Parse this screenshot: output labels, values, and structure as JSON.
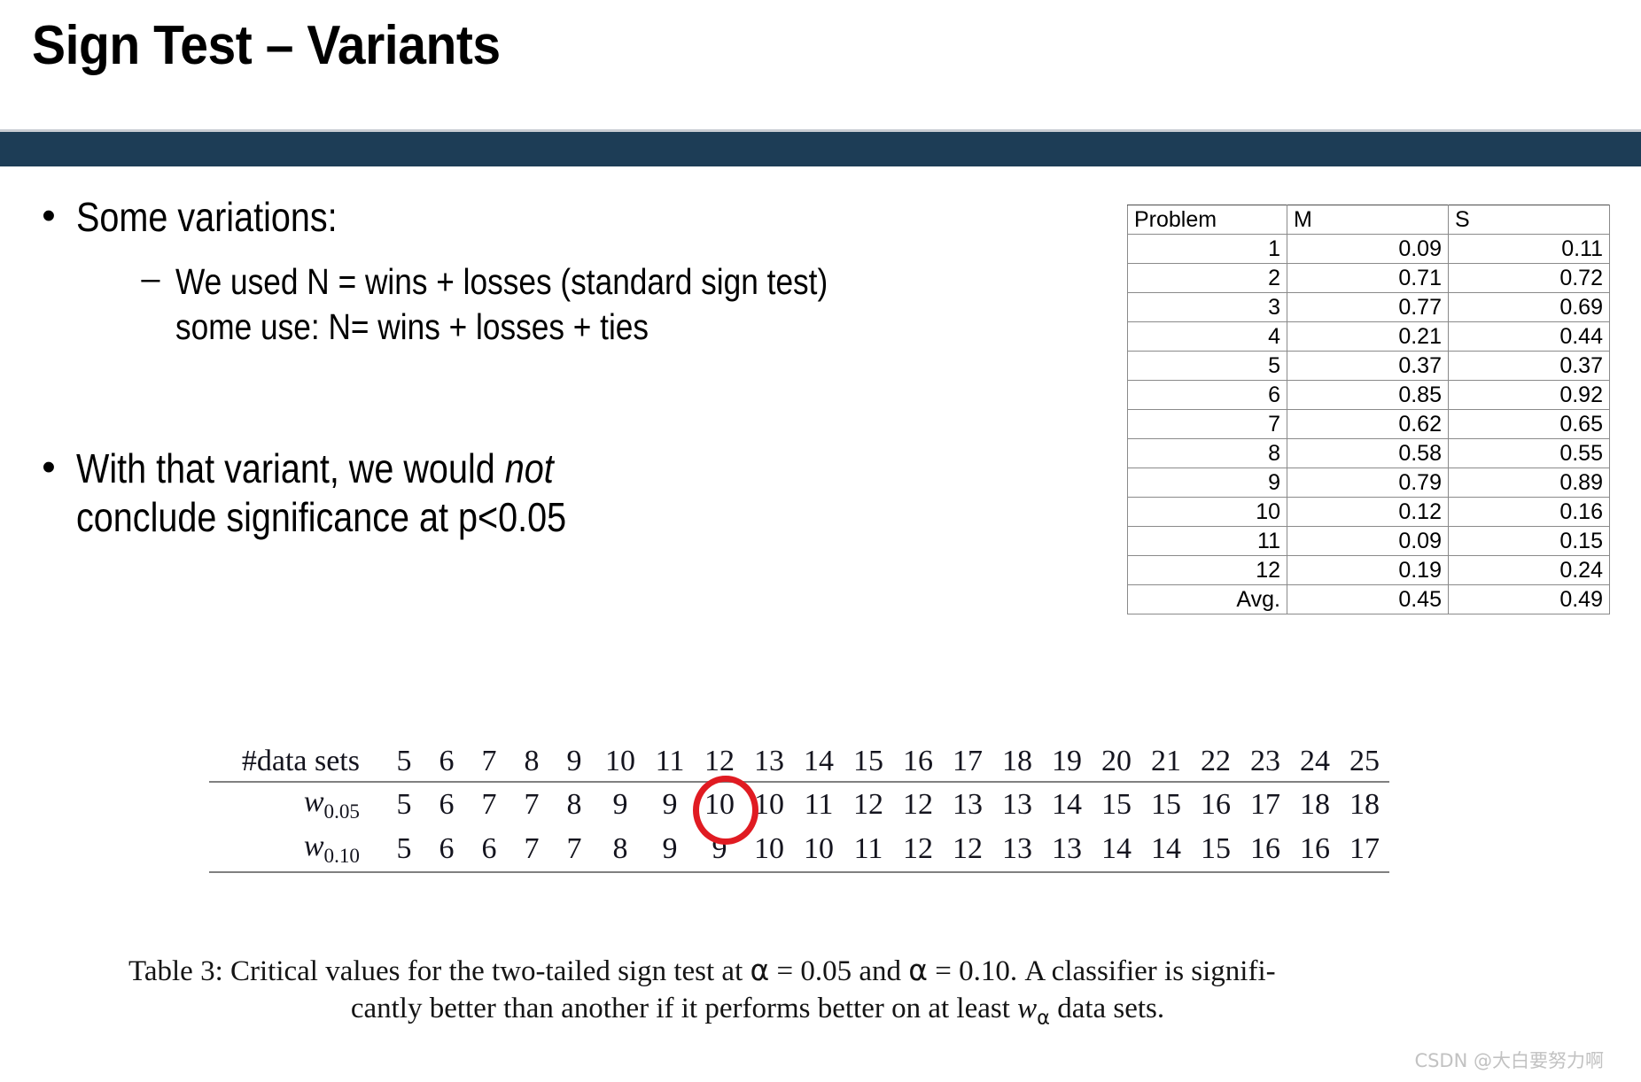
{
  "slide": {
    "title": "Sign Test – Variants",
    "band_color": "#1D3D56"
  },
  "body": {
    "bullet1": {
      "marker": "•",
      "text": "Some variations:",
      "sub": {
        "marker": "–",
        "line1": "We used N = wins + losses (standard sign test)",
        "line2": "some use: N= wins + losses + ties"
      }
    },
    "bullet2": {
      "marker": "•",
      "line1_a": "With that variant, we would ",
      "line1_italic": "not",
      "line2": "conclude significance at p<0.05"
    }
  },
  "results_table": {
    "headers": [
      "Problem",
      "M",
      "S"
    ],
    "rows": [
      [
        "1",
        "0.09",
        "0.11"
      ],
      [
        "2",
        "0.71",
        "0.72"
      ],
      [
        "3",
        "0.77",
        "0.69"
      ],
      [
        "4",
        "0.21",
        "0.44"
      ],
      [
        "5",
        "0.37",
        "0.37"
      ],
      [
        "6",
        "0.85",
        "0.92"
      ],
      [
        "7",
        "0.62",
        "0.65"
      ],
      [
        "8",
        "0.58",
        "0.55"
      ],
      [
        "9",
        "0.79",
        "0.89"
      ],
      [
        "10",
        "0.12",
        "0.16"
      ],
      [
        "11",
        "0.09",
        "0.15"
      ],
      [
        "12",
        "0.19",
        "0.24"
      ],
      [
        "Avg.",
        "0.45",
        "0.49"
      ]
    ]
  },
  "chart_data": {
    "type": "table",
    "title": "Table 3: Critical values for the two-tailed sign test",
    "row_labels": [
      "#data sets",
      "w0.05",
      "w0.10"
    ],
    "categories": [
      5,
      6,
      7,
      8,
      9,
      10,
      11,
      12,
      13,
      14,
      15,
      16,
      17,
      18,
      19,
      20,
      21,
      22,
      23,
      24,
      25
    ],
    "series": [
      {
        "name": "w_0.05",
        "values": [
          5,
          6,
          7,
          7,
          8,
          9,
          9,
          10,
          10,
          11,
          12,
          12,
          13,
          13,
          14,
          15,
          15,
          16,
          17,
          18,
          18
        ]
      },
      {
        "name": "w_0.10",
        "values": [
          5,
          6,
          6,
          7,
          7,
          8,
          9,
          9,
          10,
          10,
          11,
          12,
          12,
          13,
          13,
          14,
          14,
          15,
          16,
          16,
          17
        ]
      }
    ],
    "highlight": {
      "series": "w_0.05",
      "category": 12,
      "value": 10,
      "shape": "ellipse",
      "color": "#E01B22"
    },
    "xlabel": "#data sets",
    "ylabel": "",
    "grid": false,
    "legend": "none"
  },
  "critical_table": {
    "label_datasets": "#data sets",
    "label_w005_base": "w",
    "label_w005_sub": "0.05",
    "label_w010_base": "w",
    "label_w010_sub": "0.10"
  },
  "caption": {
    "line1_part1": "Table 3:  Critical values for the two-tailed sign test at ",
    "alpha1": "α",
    "line1_part2": " = 0.05 and ",
    "alpha2": "α",
    "line1_part3": " = 0.10. A classifier is signifi-",
    "line2_part1": "cantly better than another if it performs better on at least ",
    "w_base": "w",
    "w_sub": "α",
    "line2_part2": " data sets."
  },
  "watermark": {
    "text": "CSDN @大白要努力啊"
  }
}
